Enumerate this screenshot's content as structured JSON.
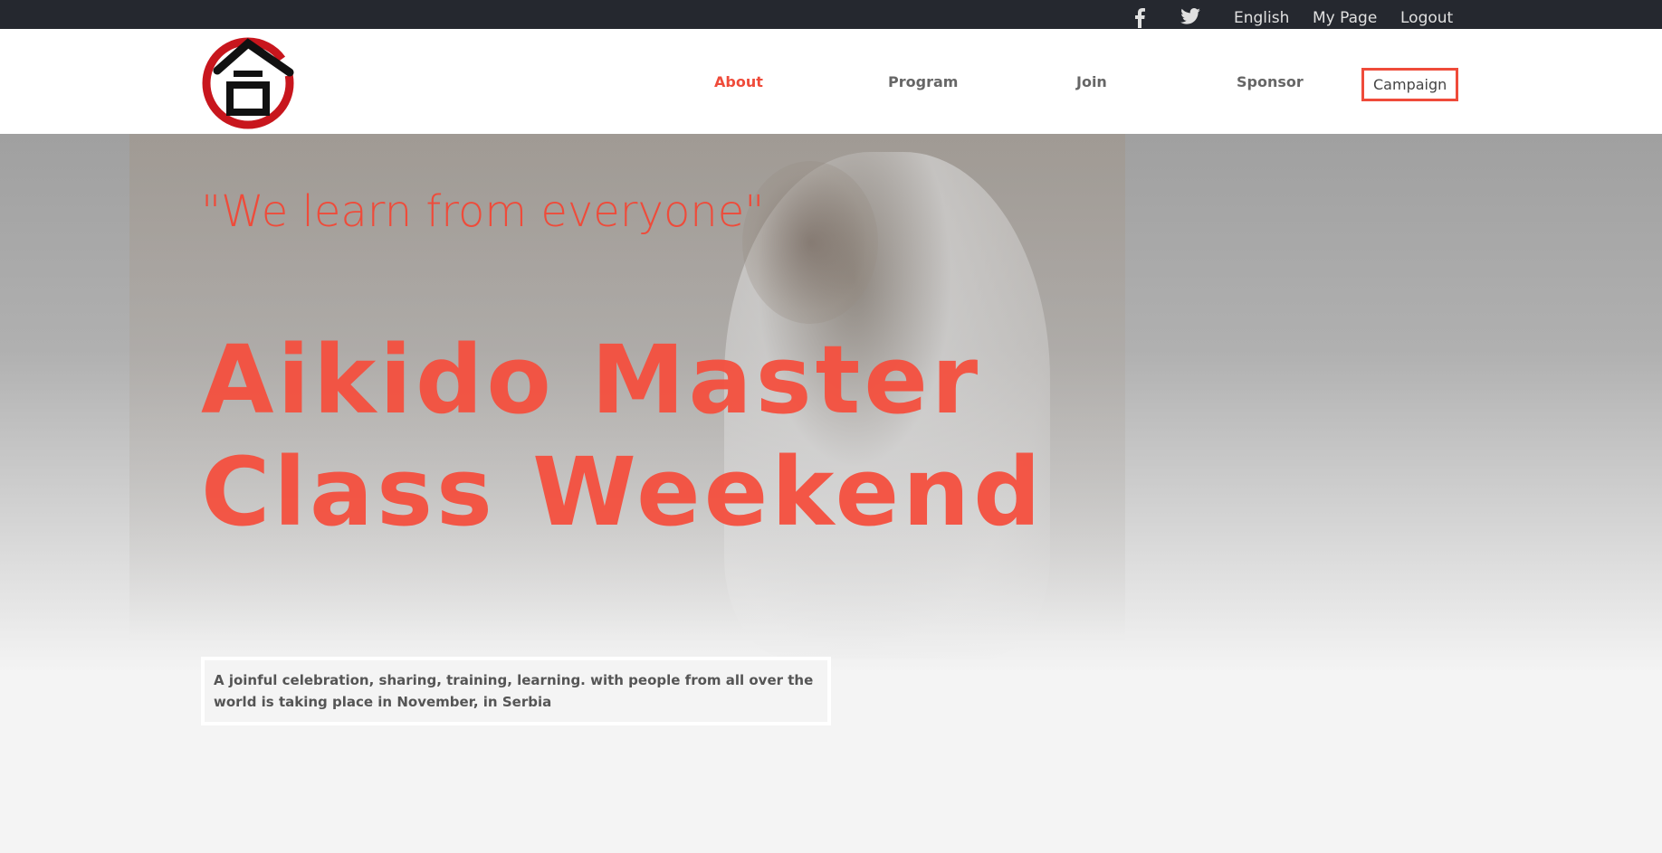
{
  "topbar": {
    "facebook_icon": "facebook-icon",
    "twitter_icon": "twitter-icon",
    "language": "English",
    "my_page": "My Page",
    "logout": "Logout"
  },
  "header": {
    "logo_icon": "aikido-kanji-logo",
    "nav": {
      "about": "About",
      "program": "Program",
      "join": "Join",
      "sponsor": "Sponsor",
      "campaign": "Campaign"
    },
    "colors": {
      "accent": "#ef4b3a",
      "topbar": "#25282f"
    }
  },
  "hero": {
    "quote": "\"We learn from everyone\"",
    "headline_line1": "Aikido Master",
    "headline_line2": "Class Weekend",
    "description": "A joinful celebration, sharing, training, learning. with people from all over the world is taking place in November, in Serbia"
  }
}
